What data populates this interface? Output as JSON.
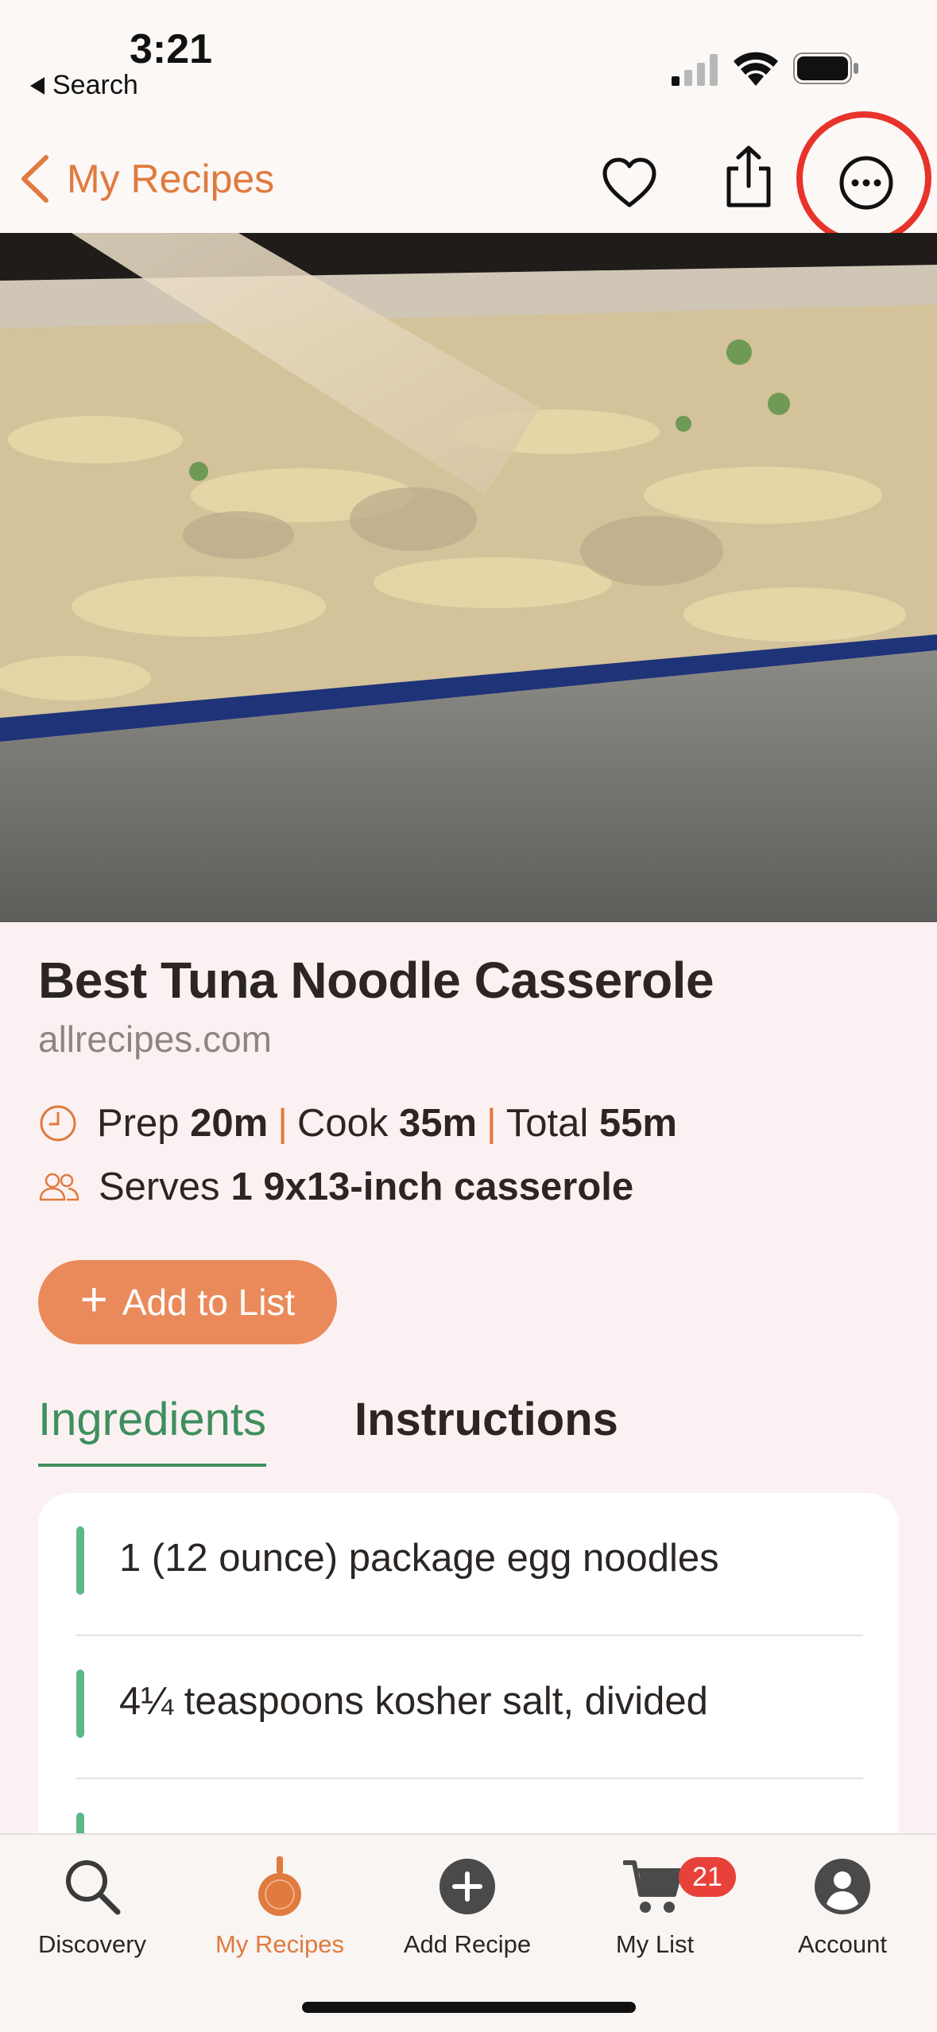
{
  "status_bar": {
    "time": "3:21",
    "back_app": "Search"
  },
  "nav": {
    "back_label": "My Recipes",
    "icons": [
      "chevron-left-icon",
      "heart-icon",
      "share-icon",
      "more-icon"
    ]
  },
  "recipe": {
    "title": "Best Tuna Noodle Casserole",
    "source": "allrecipes.com",
    "prep_label": "Prep",
    "prep_value": "20m",
    "cook_label": "Cook",
    "cook_value": "35m",
    "total_label": "Total",
    "total_value": "55m",
    "separator": "|",
    "serves_label": "Serves",
    "serves_value": "1 9x13-inch casserole"
  },
  "actions": {
    "add_to_list": "Add to List"
  },
  "tabs": {
    "ingredients": "Ingredients",
    "instructions": "Instructions",
    "active": "Ingredients"
  },
  "ingredients": [
    "1 (12 ounce) package egg noodles",
    "4¼ teaspoons kosher salt, divided"
  ],
  "tab_bar": {
    "items": [
      {
        "label": "Discovery",
        "icon": "search-icon"
      },
      {
        "label": "My Recipes",
        "icon": "pan-icon"
      },
      {
        "label": "Add Recipe",
        "icon": "plus-circle-icon"
      },
      {
        "label": "My List",
        "icon": "cart-icon"
      },
      {
        "label": "Account",
        "icon": "account-icon"
      }
    ],
    "active": "My Recipes",
    "list_badge": "21"
  },
  "colors": {
    "accent": "#e07a3e",
    "button": "#ea8a5b",
    "tab_active": "#3f8f5e",
    "ingredient_marker": "#5db986",
    "badge": "#e8413a",
    "highlight_circle": "#e8332a"
  }
}
